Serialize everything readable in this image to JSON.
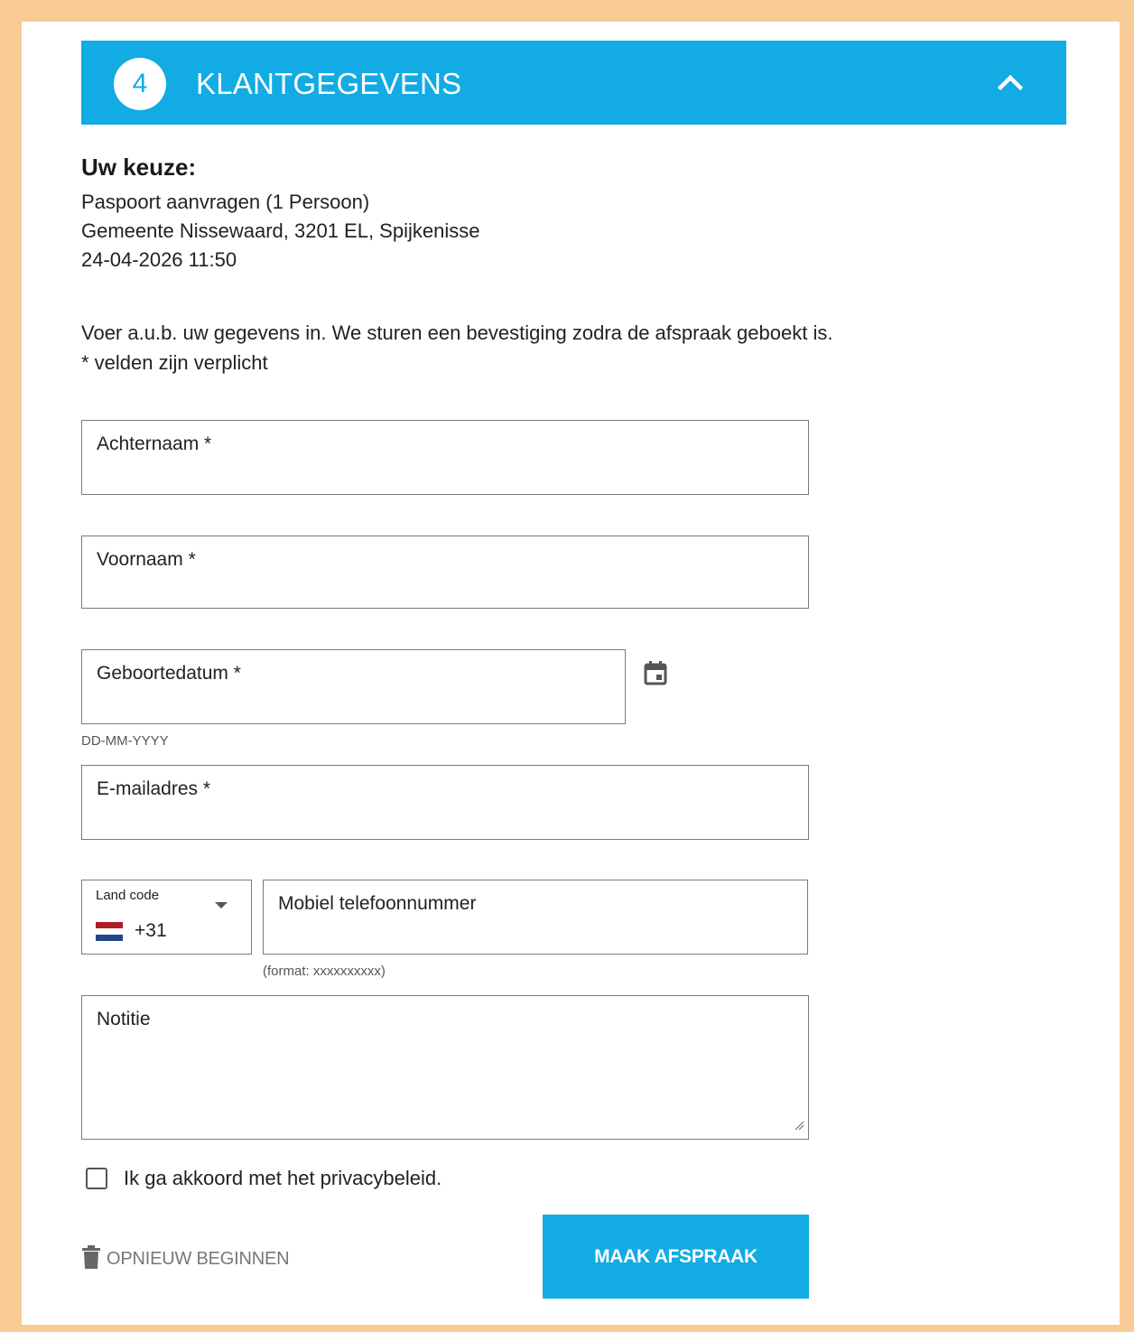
{
  "header": {
    "step_number": "4",
    "title": "KLANTGEGEVENS",
    "collapse_icon": "chevron-up-icon",
    "accent_color": "#12abe3"
  },
  "choice": {
    "heading": "Uw keuze:",
    "service": "Paspoort aanvragen (1 Persoon)",
    "location": "Gemeente Nissewaard, 3201 EL, Spijkenisse",
    "datetime": "24-04-2026 11:50"
  },
  "intro": {
    "line1": "Voer a.u.b. uw gegevens in. We sturen een bevestiging zodra de afspraak geboekt is.",
    "line2": "* velden zijn verplicht"
  },
  "form": {
    "lastname_label": "Achternaam *",
    "firstname_label": "Voornaam *",
    "birthdate_label": "Geboortedatum *",
    "birthdate_hint": "DD-MM-YYYY",
    "email_label": "E-mailadres *",
    "country_code_label": "Land code",
    "country_code_value": "+31",
    "phone_label": "Mobiel telefoonnummer",
    "phone_hint": "(format: xxxxxxxxxx)",
    "note_label": "Notitie",
    "privacy_label": "Ik ga akkoord met het privacybeleid.",
    "privacy_checked": false
  },
  "actions": {
    "restart_label": "OPNIEUW BEGINNEN",
    "submit_label": "MAAK AFSPRAAK"
  }
}
